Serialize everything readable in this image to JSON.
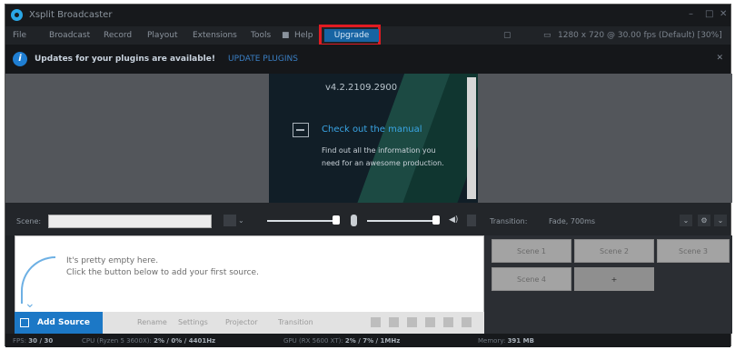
{
  "app": {
    "title": "Xsplit Broadcaster"
  },
  "window_controls": [
    "–",
    "□",
    "✕"
  ],
  "menu": {
    "items": [
      "File",
      "Broadcast",
      "Record",
      "Playout",
      "Extensions",
      "Tools",
      "Help"
    ],
    "upgrade": "Upgrade",
    "resolution": "1280 x 720 @ 30.00 fps (Default) [30%]"
  },
  "notice": {
    "text": "Updates for your plugins are available!",
    "link": "UPDATE PLUGINS",
    "close": "✕"
  },
  "preview_card": {
    "version": "v4.2.2109.2900",
    "title": "Check out the manual",
    "body": "Find out all the information you need for an awesome production."
  },
  "controls": {
    "scene_label": "Scene:",
    "transition_label": "Transition:",
    "transition_value": "Fade, 700ms"
  },
  "sources": {
    "empty_line1": "It's pretty empty here.",
    "empty_line2": "Click the button below to add your first source.",
    "add_source": "Add Source",
    "toolbar": [
      "Rename",
      "Settings",
      "Projector",
      "Transition"
    ]
  },
  "scenes": [
    "Scene 1",
    "Scene 2",
    "Scene 3",
    "Scene 4",
    "+"
  ],
  "status": {
    "fps_label": "FPS:",
    "fps_value": "30 / 30",
    "cpu_label": "CPU (Ryzen 5 3600X):",
    "cpu_value": "2% / 0% / 4401Hz",
    "gpu_label": "GPU (RX 5600 XT):",
    "gpu_value": "2% / 7% / 1MHz",
    "mem_label": "Memory:",
    "mem_value": "391 MB"
  }
}
